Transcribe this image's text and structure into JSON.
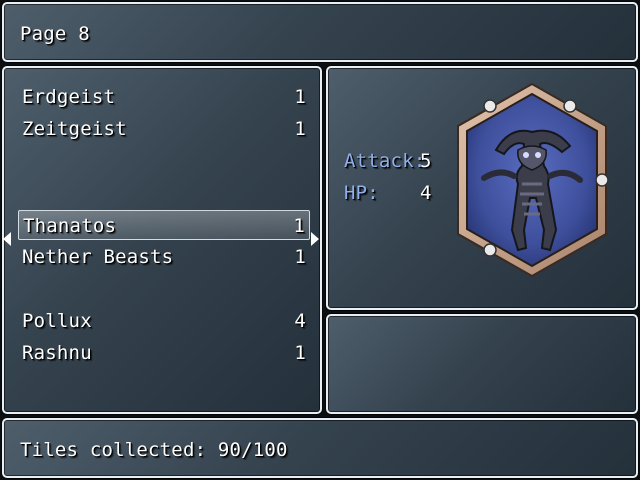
{
  "header": {
    "title": "Page 8"
  },
  "list": {
    "rows": [
      {
        "name": "Erdgeist",
        "qty": "1"
      },
      {
        "name": "Zeitgeist",
        "qty": "1"
      },
      {
        "name": "",
        "qty": ""
      },
      {
        "name": "",
        "qty": ""
      },
      {
        "name": "Thanatos",
        "qty": "1",
        "selected": true
      },
      {
        "name": "Nether Beasts",
        "qty": "1"
      },
      {
        "name": "",
        "qty": ""
      },
      {
        "name": "Pollux",
        "qty": "4"
      },
      {
        "name": "Rashnu",
        "qty": "1"
      }
    ]
  },
  "stats": {
    "attack_label": "Attack:",
    "attack_value": "5",
    "hp_label": "HP:",
    "hp_value": "4"
  },
  "card": {
    "frame_color": "#c9a48a",
    "art_bg": "#3e4f9c",
    "icon": "thanatos-portrait"
  },
  "footer": {
    "text": "Tiles collected: 90/100"
  },
  "colors": {
    "window_border": "#e8eef2",
    "label_blue": "#8fb0e8",
    "text": "#ffffff"
  }
}
